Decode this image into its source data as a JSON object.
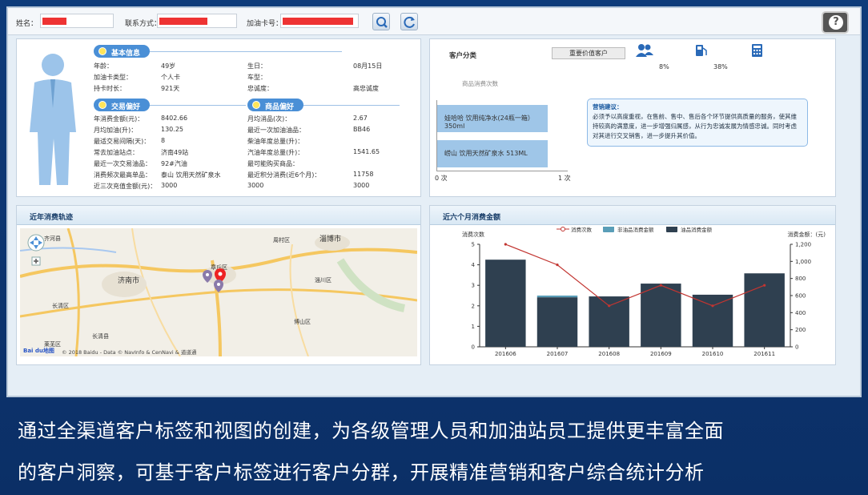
{
  "search": {
    "name_label": "姓名：",
    "contact_label": "联系方式：",
    "card_label": "加油卡号："
  },
  "profile": {
    "basic_title": "基本信息",
    "basic_rows": [
      {
        "l1": "年龄：",
        "v1": "49岁",
        "l2": "生日：",
        "v2": "08月15日"
      },
      {
        "l1": "加油卡类型：",
        "v1": "个人卡",
        "l2": "车型：",
        "v2": ""
      },
      {
        "l1": "持卡时长：",
        "v1": "921天",
        "l2": "忠诚度：",
        "v2": "高忠诚度"
      }
    ],
    "trade_title": "交易偏好",
    "goods_title": "商品偏好",
    "trade_rows": [
      {
        "l1": "年消费金额(元)：",
        "v1": "8402.66",
        "l2": "月均消品(次)：",
        "v2": "2.67"
      },
      {
        "l1": "月均加油(升)：",
        "v1": "130.25",
        "l2": "最近一次加油油品：",
        "v2": "BB46"
      },
      {
        "l1": "最适交易间隔(天)：",
        "v1": "8",
        "l2": "柴油年度总量(升)：",
        "v2": ""
      },
      {
        "l1": "常去加油站点：",
        "v1": "济南49站",
        "l2": "汽油年度总量(升)：",
        "v2": "1541.65"
      },
      {
        "l1": "最近一次交易油品：",
        "v1": "92#汽油",
        "l2": "最可能购买商品：",
        "v2": ""
      },
      {
        "l1": "消费频次最高单品：",
        "v1": "泰山 饮用天然矿泉水",
        "l2": "最近积分消费(近6个月)：",
        "v2": "11758"
      },
      {
        "l1": "近三次充值金额(元)：",
        "v1": "3000",
        "l2": "3000",
        "v2": "3000"
      }
    ]
  },
  "classify": {
    "title": "客户分类",
    "button": "重要价值客户",
    "stat1": "8%",
    "stat2": "38%",
    "sub_label": "商品消费次数",
    "bars": [
      {
        "label": "娃哈哈 饮用纯净水(24瓶一箱） 350ml",
        "value": 0.85
      },
      {
        "label": "崂山 饮用天然矿泉水 513ML",
        "value": 0.85
      }
    ],
    "axis_left": "0 次",
    "axis_right": "1 次",
    "tip_title": "营销建议：",
    "tip_body": "必须予以高度重视，在售前、售中、售后各个环节提供高质量的服务，使其维持较高的满意度，进一步增强归属感，从行为忠诚发展为情感忠诚。同时考虑对其进行交叉销售，进一步提升其价值。"
  },
  "map": {
    "title": "近年消费轨迹",
    "cities": [
      "齐河县",
      "济南市",
      "长清区",
      "章丘区",
      "淄博市",
      "周村区",
      "博山区",
      "莱芜区",
      "淄川区",
      "长清县"
    ],
    "copyright": "© 2018 Baidu - Data © NavInfo & CenNavi & 道道通",
    "logo": "Bai du地图"
  },
  "chart_panel": {
    "title": "近六个月消费金额"
  },
  "chart_data": {
    "type": "bar",
    "categories": [
      "201606",
      "201607",
      "201608",
      "201609",
      "201610",
      "201611"
    ],
    "series": [
      {
        "name": "非油品消费金额",
        "values": [
          0,
          20,
          0,
          0,
          0,
          0
        ]
      },
      {
        "name": "油品消费金额",
        "values": [
          1020,
          580,
          590,
          740,
          610,
          860
        ]
      },
      {
        "name": "消费次数",
        "values": [
          5,
          4,
          2,
          3,
          2,
          3
        ]
      }
    ],
    "ylabel": "消费次数",
    "y2label": "消费金额：(元)",
    "ylim": [
      0,
      5
    ],
    "y2lim": [
      0,
      1200
    ],
    "yticks": [
      "0",
      "1",
      "2",
      "3",
      "4",
      "5"
    ],
    "y2ticks": [
      "0",
      "200",
      "400",
      "600",
      "800",
      "1,000",
      "1,200"
    ],
    "legend": "top",
    "colors": {
      "line": "#c23531",
      "nonoil": "#5a9eb8",
      "oil": "#2f4050"
    }
  },
  "caption": {
    "line1": "通过全渠道客户标签和视图的创建，为各级管理人员和加油站员工提供更丰富全面",
    "line2": "的客户洞察，可基于客户标签进行客户分群，开展精准营销和客户综合统计分析"
  }
}
